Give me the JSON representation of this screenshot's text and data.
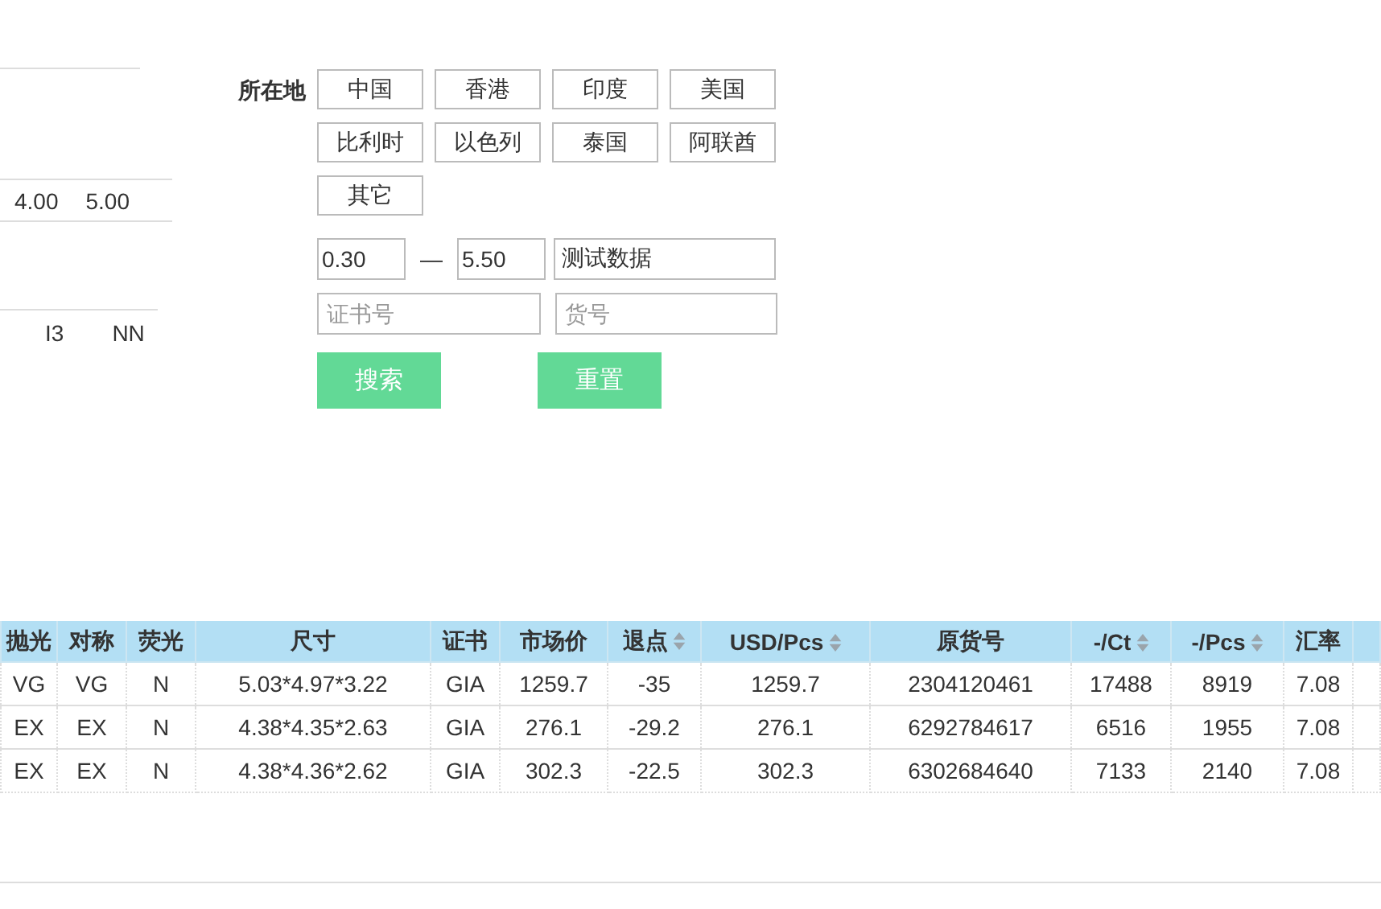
{
  "left_panel": {
    "row_1": [
      "4.00",
      "5.00"
    ],
    "row_2": [
      "I3",
      "NN"
    ]
  },
  "filter": {
    "location_label": "所在地",
    "locations": [
      "中国",
      "香港",
      "印度",
      "美国",
      "比利时",
      "以色列",
      "泰国",
      "阿联酋",
      "其它"
    ],
    "range": {
      "from": "0.30",
      "separator": "—",
      "to": "5.50"
    },
    "keyword": {
      "value": "测试数据"
    },
    "certificate": {
      "placeholder": "证书号"
    },
    "stock_no": {
      "placeholder": "货号"
    },
    "buttons": [
      "搜索",
      "重置"
    ]
  },
  "table": {
    "columns": [
      {
        "label": "抛光",
        "sortable": false
      },
      {
        "label": "对称",
        "sortable": false
      },
      {
        "label": "荧光",
        "sortable": false
      },
      {
        "label": "尺寸",
        "sortable": false
      },
      {
        "label": "证书",
        "sortable": false
      },
      {
        "label": "市场价",
        "sortable": false
      },
      {
        "label": "退点",
        "sortable": true
      },
      {
        "label": "USD/Pcs",
        "sortable": true
      },
      {
        "label": "原货号",
        "sortable": false
      },
      {
        "label": "-/Ct",
        "sortable": true
      },
      {
        "label": "-/Pcs",
        "sortable": true
      },
      {
        "label": "汇率",
        "sortable": false
      }
    ],
    "rows": [
      [
        "VG",
        "VG",
        "N",
        "5.03*4.97*3.22",
        "GIA",
        "1259.7",
        "-35",
        "1259.7",
        "2304120461",
        "17488",
        "8919",
        "7.08"
      ],
      [
        "EX",
        "EX",
        "N",
        "4.38*4.35*2.63",
        "GIA",
        "276.1",
        "-29.2",
        "276.1",
        "6292784617",
        "6516",
        "1955",
        "7.08"
      ],
      [
        "EX",
        "EX",
        "N",
        "4.38*4.36*2.62",
        "GIA",
        "302.3",
        "-22.5",
        "302.3",
        "6302684640",
        "7133",
        "2140",
        "7.08"
      ]
    ]
  }
}
